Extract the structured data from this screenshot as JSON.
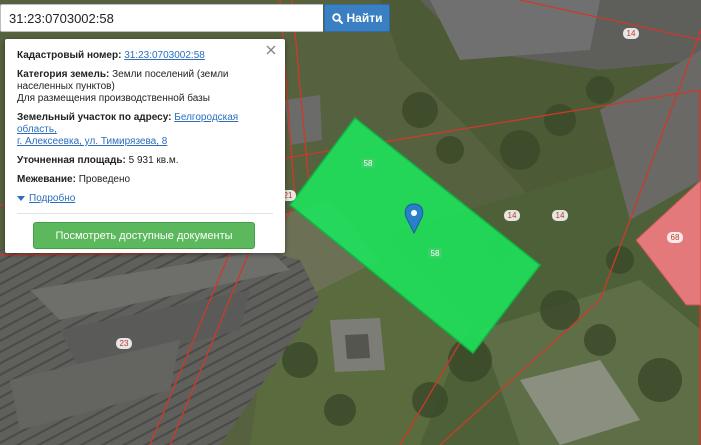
{
  "search": {
    "value": "31:23:0703002:58",
    "button_label": "Найти"
  },
  "map": {
    "labels": [
      "14",
      "14",
      "14",
      "21",
      "23",
      "58",
      "58",
      "68"
    ],
    "parcel_fill": "#1fe05a",
    "parcel_border": "#0fb544",
    "boundary_color": "#cc3a2a",
    "neighbor_fill": "#e3797a"
  },
  "info": {
    "cadastral_label": "Кадастровый номер:",
    "cadastral_value": "31:23:0703002:58",
    "category_label": "Категория земель:",
    "category_value": "Земли поселений (земли",
    "category_value_2": "населенных пунктов)",
    "usage": "Для размещения производственной базы",
    "address_label": "Земельный участок по адресу:",
    "address_value": "Белгородская область,",
    "address_value_2": "г. Алексеевка, ул. Тимирязева, 8",
    "area_label": "Уточненная площадь:",
    "area_value": "5 931 кв.м.",
    "survey_label": "Межевание:",
    "survey_value": "Проведено",
    "more_label": "Подробно",
    "docs_button": "Посмотреть доступные документы"
  },
  "colors": {
    "accent": "#3a7fc1",
    "link": "#2a6ebd",
    "button_green": "#5cb85c"
  }
}
